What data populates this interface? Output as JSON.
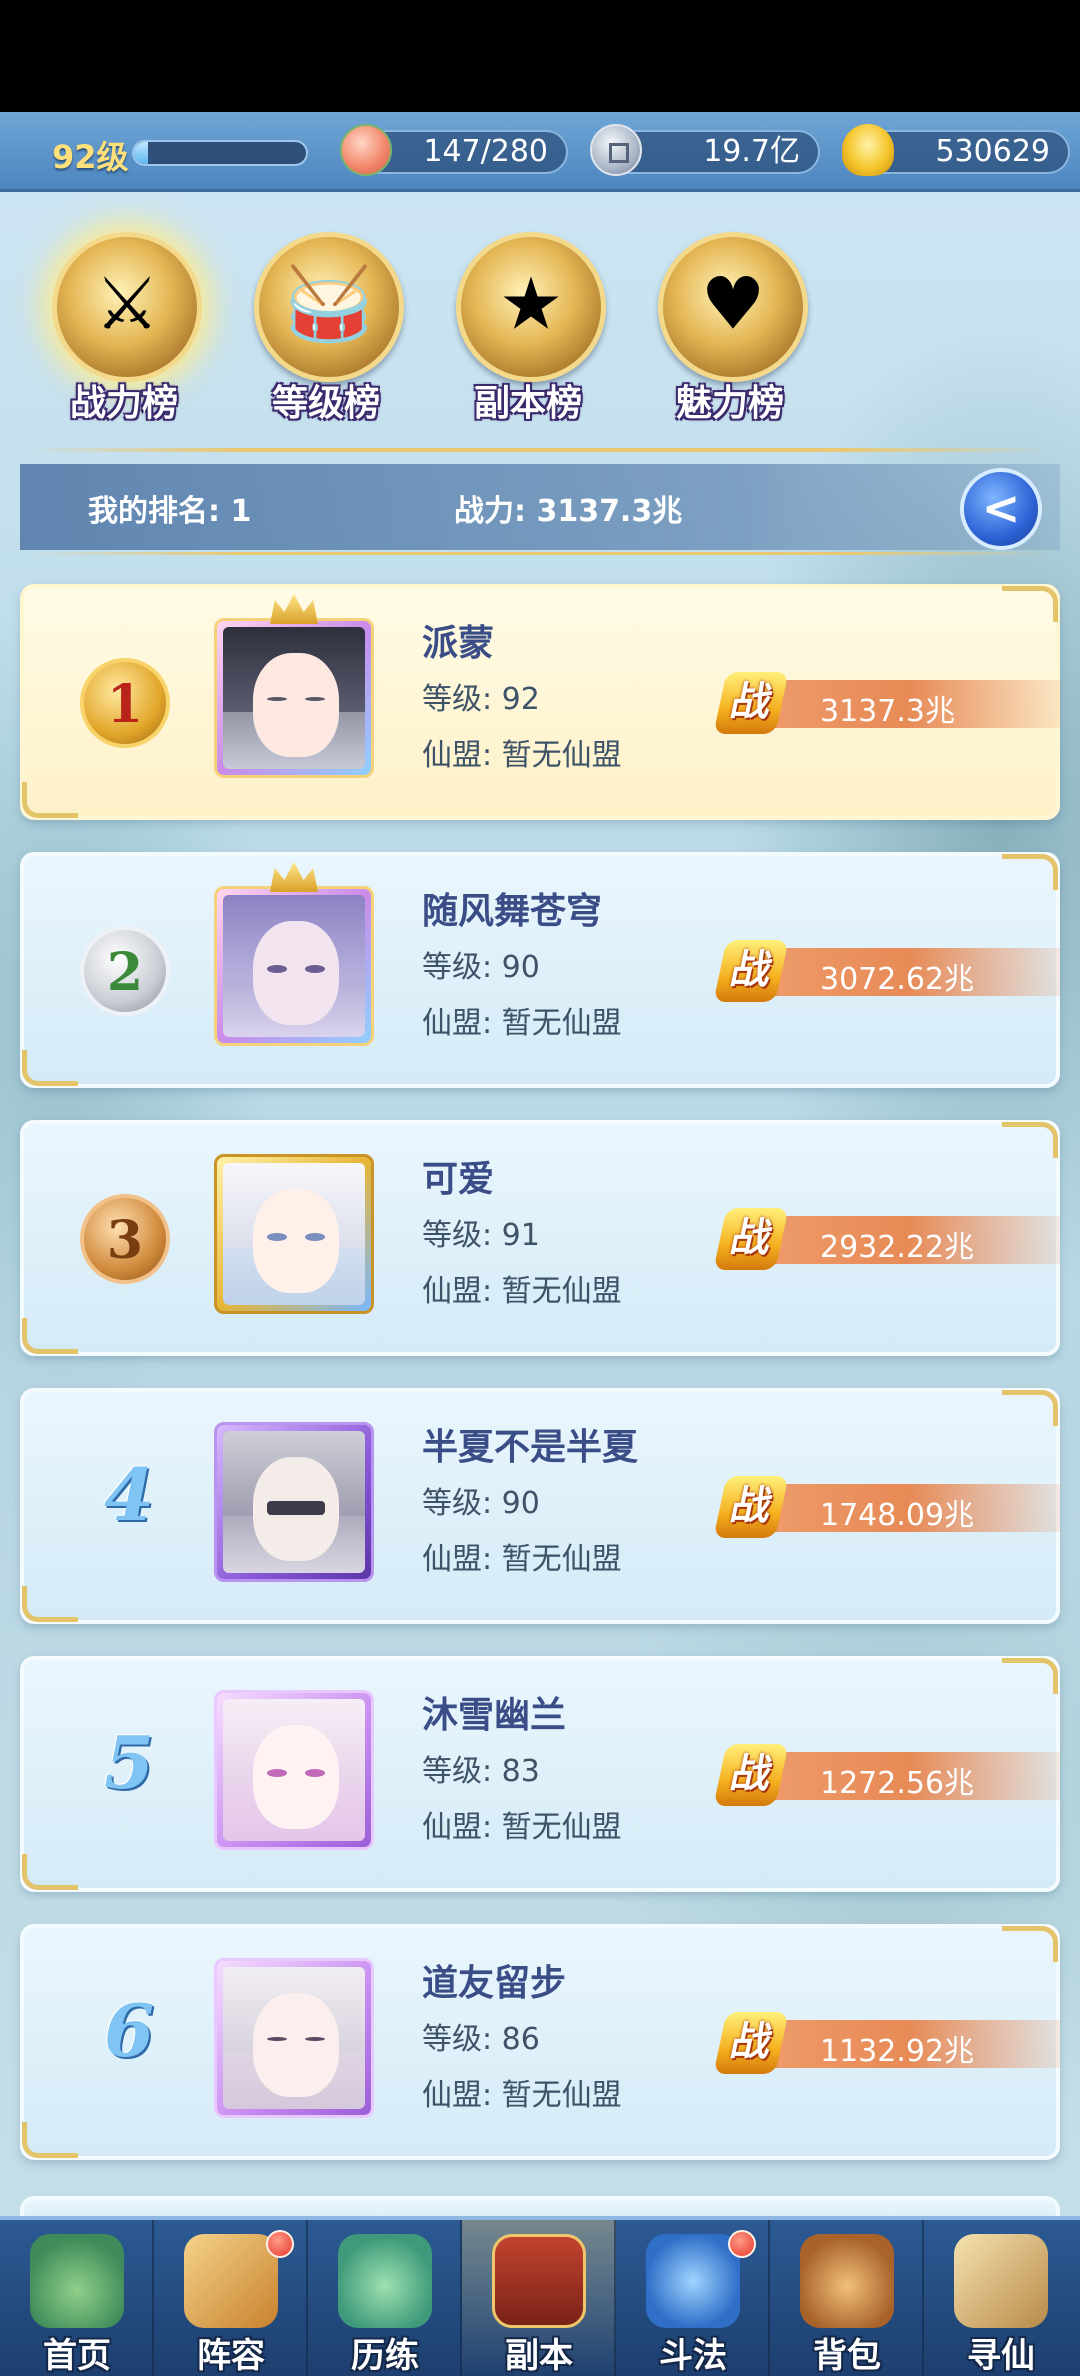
{
  "topbar": {
    "level": "92级",
    "level_progress": 0.08,
    "stamina": "147/280",
    "silver": "19.7亿",
    "gold": "530629",
    "icons": [
      "peach-icon",
      "coin-icon",
      "gold-ingot-icon"
    ]
  },
  "tabs": [
    {
      "label": "战力榜",
      "icon": "sword-icon",
      "active": true
    },
    {
      "label": "等级榜",
      "icon": "drum-icon",
      "active": false
    },
    {
      "label": "副本榜",
      "icon": "star-icon",
      "active": false
    },
    {
      "label": "魅力榜",
      "icon": "heart-icon",
      "active": false
    }
  ],
  "my_rank": {
    "rank_text": "我的排名: 1",
    "power_text": "战力: 3137.3兆",
    "back_icon": "back-arrow-icon"
  },
  "ranking": [
    {
      "rank": "1",
      "name": "派蒙",
      "level": "等级: 92",
      "guild": "仙盟: 暂无仙盟",
      "power_label": "战",
      "power": "3137.3兆"
    },
    {
      "rank": "2",
      "name": "随风舞苍穹",
      "level": "等级: 90",
      "guild": "仙盟: 暂无仙盟",
      "power_label": "战",
      "power": "3072.62兆"
    },
    {
      "rank": "3",
      "name": "可爱",
      "level": "等级: 91",
      "guild": "仙盟: 暂无仙盟",
      "power_label": "战",
      "power": "2932.22兆"
    },
    {
      "rank": "4",
      "name": "半夏不是半夏",
      "level": "等级: 90",
      "guild": "仙盟: 暂无仙盟",
      "power_label": "战",
      "power": "1748.09兆"
    },
    {
      "rank": "5",
      "name": "沐雪幽兰",
      "level": "等级: 83",
      "guild": "仙盟: 暂无仙盟",
      "power_label": "战",
      "power": "1272.56兆"
    },
    {
      "rank": "6",
      "name": "道友留步",
      "level": "等级: 86",
      "guild": "仙盟: 暂无仙盟",
      "power_label": "战",
      "power": "1132.92兆"
    }
  ],
  "bottom_nav": [
    {
      "label": "首页",
      "icon": "home-mountain-icon",
      "badge": false
    },
    {
      "label": "阵容",
      "icon": "formation-cards-icon",
      "badge": true
    },
    {
      "label": "历练",
      "icon": "gourd-icon",
      "badge": false
    },
    {
      "label": "副本",
      "icon": "temple-gate-icon",
      "badge": false
    },
    {
      "label": "斗法",
      "icon": "arena-icon",
      "badge": true
    },
    {
      "label": "背包",
      "icon": "bag-icon",
      "badge": false
    },
    {
      "label": "寻仙",
      "icon": "scroll-icon",
      "badge": false
    }
  ],
  "colors": {
    "topbar": "#5a92c8",
    "card_bg": "#dff0fa",
    "first_card_bg": "#fdf3cf",
    "power_bar": "#e78a56",
    "name_text": "#3a4d86",
    "nav_bg": "#234a7f"
  }
}
